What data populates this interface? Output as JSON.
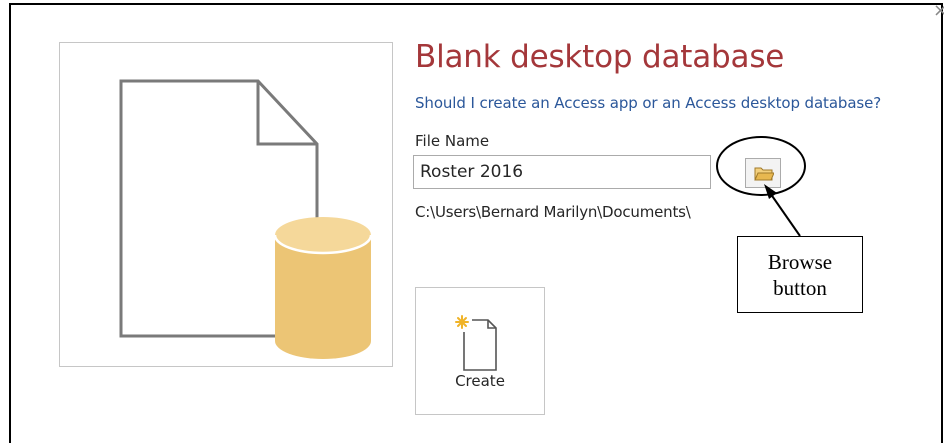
{
  "dialog": {
    "close_glyph": "×",
    "title": "Blank desktop database",
    "help_link": "Should I create an Access app or an Access desktop database?",
    "file_name_label": "File Name",
    "file_name_value": "Roster 2016",
    "save_path": "C:\\Users\\Bernard Marilyn\\Documents\\",
    "create_label": "Create"
  },
  "annotation": {
    "callout_line1": "Browse",
    "callout_line2": "button"
  },
  "icons": {
    "preview": "blank-database-icon",
    "browse": "folder-icon",
    "create": "new-document-icon"
  },
  "colors": {
    "title": "#a4373a",
    "link": "#2b579a",
    "db_cylinder": "#ecc575",
    "folder": "#e8b850"
  }
}
